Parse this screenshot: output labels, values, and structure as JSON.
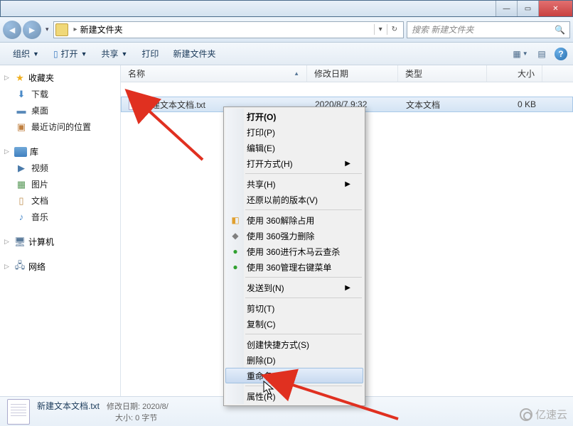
{
  "titlebar": {
    "min": "—",
    "max": "▭",
    "close": "✕"
  },
  "nav": {
    "back": "◄",
    "fwd": "►",
    "dd": "▾",
    "folder_name": "新建文件夹",
    "sep": "▸",
    "refresh": "↻",
    "search_placeholder": "搜索 新建文件夹",
    "search_icon": "🔍"
  },
  "toolbar": {
    "organize": "组织",
    "open": "打开",
    "share": "共享",
    "print": "打印",
    "newfolder": "新建文件夹",
    "view": "▦",
    "preview": "▤",
    "help": "?"
  },
  "sidebar": {
    "favorites": {
      "label": "收藏夹",
      "items": [
        "下载",
        "桌面",
        "最近访问的位置"
      ]
    },
    "libraries": {
      "label": "库",
      "items": [
        "视频",
        "图片",
        "文档",
        "音乐"
      ]
    },
    "computer": {
      "label": "计算机"
    },
    "network": {
      "label": "网络"
    }
  },
  "columns": {
    "name": "名称",
    "date": "修改日期",
    "type": "类型",
    "size": "大小"
  },
  "files": [
    {
      "name": "新建文本文档.txt",
      "date": "2020/8/7 9:32",
      "type": "文本文档",
      "size": "0 KB"
    }
  ],
  "ctx": {
    "open": "打开(O)",
    "print": "打印(P)",
    "edit": "编辑(E)",
    "openwith": "打开方式(H)",
    "share": "共享(H)",
    "restore": "还原以前的版本(V)",
    "use360unlock": "使用 360解除占用",
    "use360delete": "使用 360强力删除",
    "use360scan": "使用 360进行木马云查杀",
    "use360menu": "使用 360管理右键菜单",
    "sendto": "发送到(N)",
    "cut": "剪切(T)",
    "copy": "复制(C)",
    "shortcut": "创建快捷方式(S)",
    "delete": "删除(D)",
    "rename": "重命名(M)",
    "properties": "属性(R)",
    "submenu": "▶"
  },
  "details": {
    "name": "新建文本文档.txt",
    "meta1_label": "修改日期:",
    "meta1_value": "2020/8/",
    "meta2_label": "大小:",
    "meta2_value": "0 字节"
  },
  "watermark": "亿速云"
}
